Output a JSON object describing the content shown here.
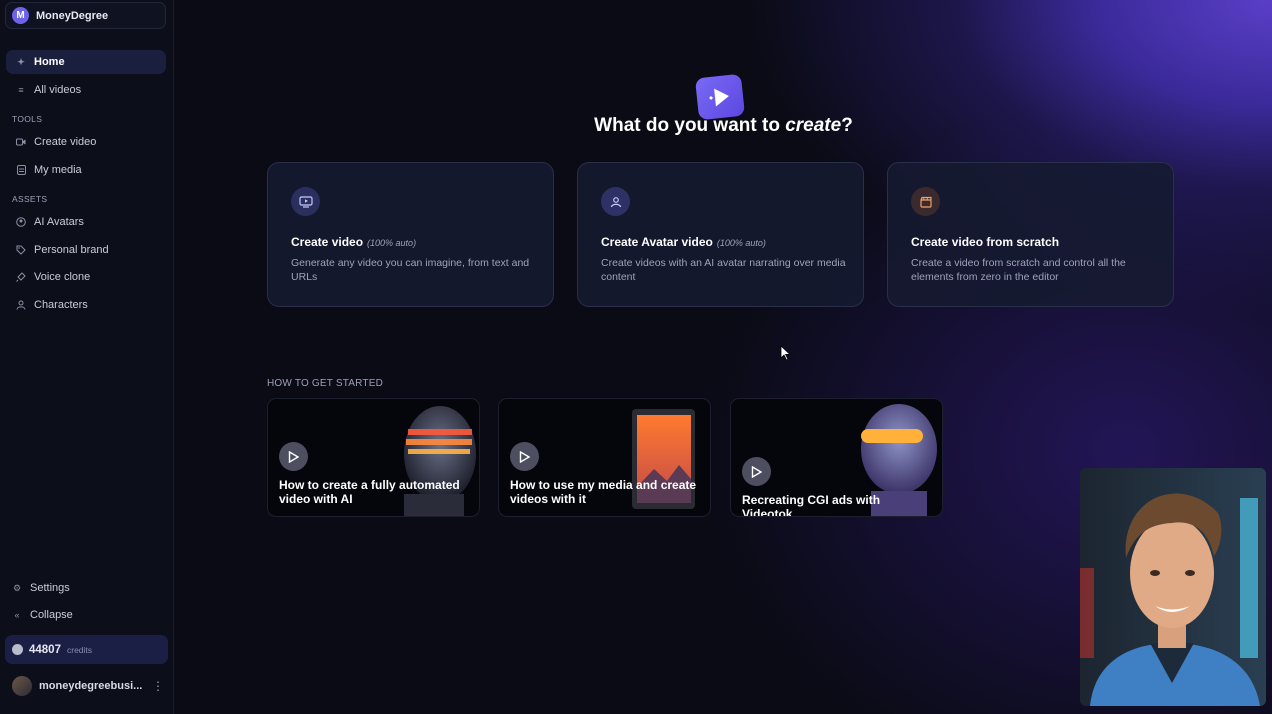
{
  "workspace": {
    "initial": "M",
    "name": "MoneyDegree"
  },
  "nav": {
    "home": "Home",
    "all_videos": "All videos",
    "tools_label": "TOOLS",
    "create_video": "Create video",
    "my_media": "My media",
    "assets_label": "ASSETS",
    "ai_avatars": "AI Avatars",
    "personal_brand": "Personal brand",
    "voice_clone": "Voice clone",
    "characters": "Characters",
    "settings": "Settings",
    "collapse": "Collapse"
  },
  "credits": {
    "value": "44807",
    "label": "credits"
  },
  "user": {
    "name": "moneydegreebusi..."
  },
  "heading": {
    "prefix": "What do you want to ",
    "emphasis": "create",
    "suffix": "?"
  },
  "cards": [
    {
      "title": "Create video",
      "tag": "(100% auto)",
      "desc": "Generate any video you can imagine, from text and URLs",
      "icon": "video-screen-icon"
    },
    {
      "title": "Create Avatar video",
      "tag": "(100% auto)",
      "desc": "Create videos with an AI avatar narrating over media content",
      "icon": "person-icon"
    },
    {
      "title": "Create video from scratch",
      "tag": "",
      "desc": "Create a video from scratch and control all the elements from zero in the editor",
      "icon": "clapperboard-icon"
    }
  ],
  "get_started": {
    "label": "HOW TO GET STARTED",
    "videos": [
      {
        "title": "How to create a fully automated video with AI"
      },
      {
        "title": "How to use my media and create videos with it"
      },
      {
        "title": "Recreating CGI ads with Videotok"
      }
    ]
  },
  "colors": {
    "accent": "#6d63e6",
    "active_nav": "#1a1f3e",
    "credits_bg": "#1c1f45"
  }
}
